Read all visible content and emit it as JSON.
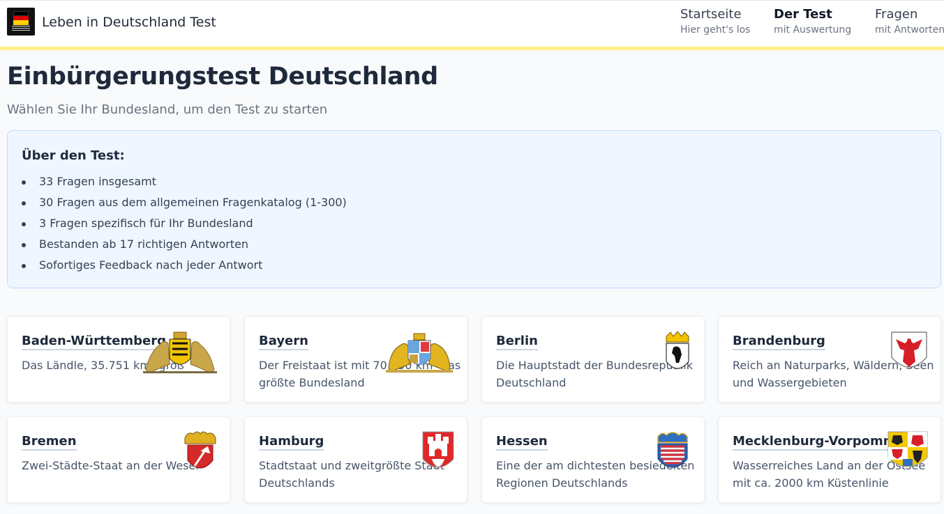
{
  "header": {
    "app_title": "Leben in Deutschland Test",
    "nav": [
      {
        "label": "Startseite",
        "sub": "Hier geht's los"
      },
      {
        "label": "Der Test",
        "sub": "mit Auswertung"
      },
      {
        "label": "Fragen",
        "sub": "mit Antworten"
      }
    ]
  },
  "main": {
    "title": "Einbürgerungstest Deutschland",
    "subtitle": "Wählen Sie Ihr Bundesland, um den Test zu starten",
    "info": {
      "title": "Über den Test:",
      "items": [
        "33 Fragen insgesamt",
        "30 Fragen aus dem allgemeinen Fragenkatalog (1-300)",
        "3 Fragen spezifisch für Ihr Bundesland",
        "Bestanden ab 17 richtigen Antworten",
        "Sofortiges Feedback nach jeder Antwort"
      ]
    },
    "states": [
      {
        "name": "Baden-Württemberg",
        "desc": "Das Ländle, 35.751 km² groß",
        "crest": "baden-wuerttemberg-coat-of-arms-icon"
      },
      {
        "name": "Bayern",
        "desc": "Der Freistaat ist mit 70.550 km² das größte Bundesland",
        "crest": "bayern-coat-of-arms-icon"
      },
      {
        "name": "Berlin",
        "desc": "Die Hauptstadt der Bundesrepublik Deutschland",
        "crest": "berlin-coat-of-arms-icon"
      },
      {
        "name": "Brandenburg",
        "desc": "Reich an Naturparks, Wäldern, Seen und Wassergebieten",
        "crest": "brandenburg-coat-of-arms-icon"
      },
      {
        "name": "Bremen",
        "desc": "Zwei-Städte-Staat an der Weser",
        "crest": "bremen-coat-of-arms-icon"
      },
      {
        "name": "Hamburg",
        "desc": "Stadtstaat und zweitgrößte Stadt Deutschlands",
        "crest": "hamburg-coat-of-arms-icon"
      },
      {
        "name": "Hessen",
        "desc": "Eine der am dichtesten besiedelten Regionen Deutschlands",
        "crest": "hessen-coat-of-arms-icon"
      },
      {
        "name": "Mecklenburg-Vorpommern",
        "desc": "Wasserreiches Land an der Ostsee mit ca. 2000 km Küstenlinie",
        "crest": "mecklenburg-vorpommern-coat-of-arms-icon"
      }
    ]
  },
  "colors": {
    "header_accent": "#fdf08a",
    "info_bg": "#eff6ff",
    "info_border": "#bfdbfe",
    "flag_black": "#000000",
    "flag_red": "#dd0000",
    "flag_gold": "#ffce00"
  }
}
